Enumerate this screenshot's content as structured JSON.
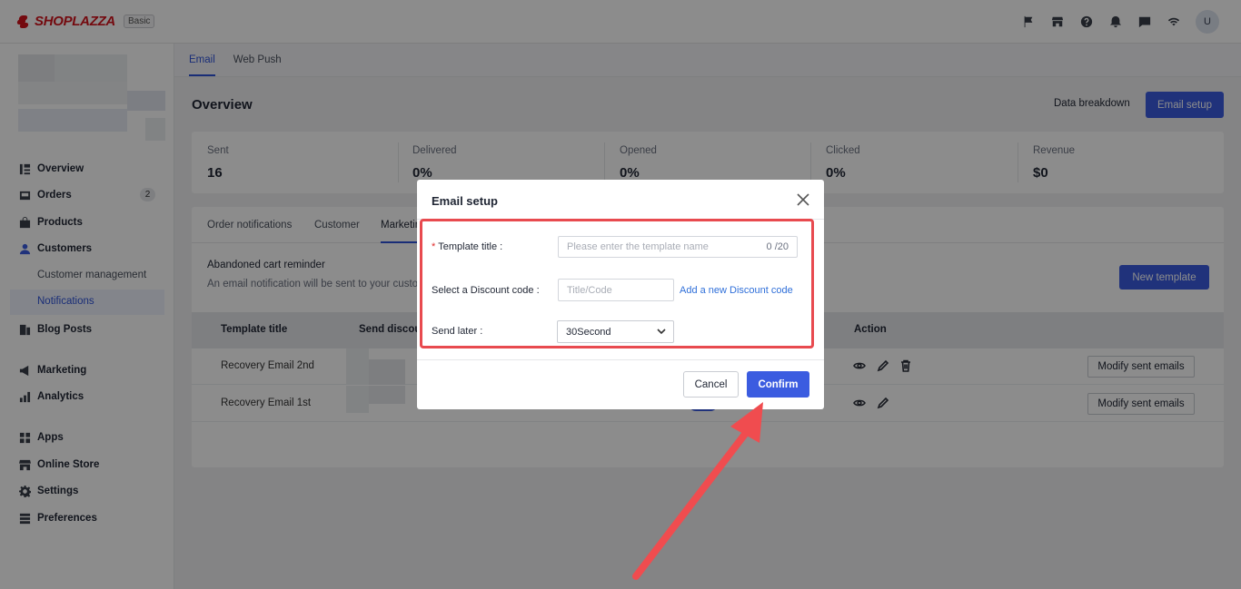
{
  "brand": {
    "name": "SHOPLAZZA",
    "plan": "Basic"
  },
  "topbar": {
    "icons": [
      "flag-icon",
      "store-icon",
      "help-icon",
      "bell-icon",
      "chat-icon",
      "wifi-icon"
    ],
    "avatar": "U"
  },
  "sidebar": {
    "items": [
      {
        "label": "Overview",
        "icon": "overview-icon"
      },
      {
        "label": "Orders",
        "icon": "orders-icon",
        "badge": "2"
      },
      {
        "label": "Products",
        "icon": "products-icon"
      },
      {
        "label": "Customers",
        "icon": "customers-icon"
      },
      {
        "label": "Blog Posts",
        "icon": "blog-icon"
      },
      {
        "label": "Marketing",
        "icon": "marketing-icon"
      },
      {
        "label": "Analytics",
        "icon": "analytics-icon"
      },
      {
        "label": "Apps",
        "icon": "apps-icon"
      },
      {
        "label": "Online Store",
        "icon": "online-store-icon"
      },
      {
        "label": "Settings",
        "icon": "settings-icon"
      },
      {
        "label": "Preferences",
        "icon": "preferences-icon"
      }
    ],
    "customer_sub": [
      "Customer management",
      "Notifications"
    ]
  },
  "main": {
    "tabs": [
      "Email",
      "Web Push"
    ],
    "title": "Overview",
    "data_breakdown": "Data breakdown",
    "email_setup_button": "Email setup",
    "stats": [
      {
        "label": "Sent",
        "value": "16"
      },
      {
        "label": "Delivered",
        "value": "0%"
      },
      {
        "label": "Opened",
        "value": "0%"
      },
      {
        "label": "Clicked",
        "value": "0%"
      },
      {
        "label": "Revenue",
        "value": "$0"
      }
    ],
    "subtabs": [
      "Order notifications",
      "Customer",
      "Marketin"
    ],
    "section_title": "Abandoned cart reminder",
    "section_desc": "An email notification will be sent to your custor",
    "new_template": "New template",
    "table": {
      "headers": [
        "Template title",
        "Send discour",
        "Action"
      ],
      "rows": [
        {
          "title": "Recovery Email 2nd",
          "modify": "Modify sent emails"
        },
        {
          "title": "Recovery Email 1st",
          "modify": "Modify sent emails"
        }
      ]
    }
  },
  "modal": {
    "title": "Email setup",
    "template_label": "Template title :",
    "template_placeholder": "Please enter the template name",
    "template_counter": "0 /20",
    "discount_label": "Select a Discount code :",
    "discount_placeholder": "Title/Code",
    "add_discount": "Add a new Discount code",
    "send_later_label": "Send later :",
    "send_later_value": "30Second",
    "cancel": "Cancel",
    "confirm": "Confirm"
  },
  "colors": {
    "primary": "#3b5ce0",
    "annotation": "#e84a4f",
    "brand": "#d3131c"
  }
}
